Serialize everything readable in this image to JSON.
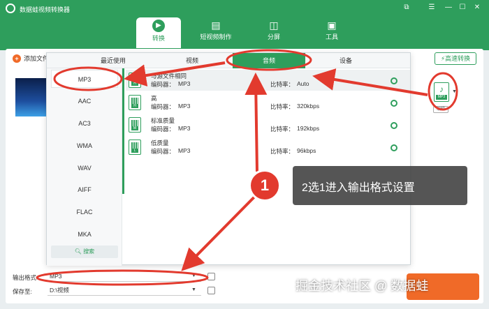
{
  "app": {
    "title": "数据蛙视频转换器"
  },
  "window_controls": [
    "⧉",
    "☰",
    "—",
    "☐",
    "✕"
  ],
  "nav_tabs": [
    {
      "label": "转换",
      "icon": "convert-icon"
    },
    {
      "label": "短视频制作",
      "icon": "film-icon"
    },
    {
      "label": "分屏",
      "icon": "split-screen-icon"
    },
    {
      "label": "工具",
      "icon": "toolbox-icon"
    }
  ],
  "toolbar": {
    "add_file": "添加文件",
    "fast_convert": "高速转换"
  },
  "output_format_icon": {
    "glyph": "♪",
    "label": "MP3",
    "edit": "编辑"
  },
  "popup": {
    "tabs": [
      "最近使用",
      "视频",
      "音频",
      "设备"
    ],
    "active_tab": "音频",
    "formats": [
      "MP3",
      "AAC",
      "AC3",
      "WMA",
      "WAV",
      "AIFF",
      "FLAC",
      "MKA"
    ],
    "active_format": "MP3",
    "search_label": "搜索",
    "codec_label": "编码器：",
    "bitrate_label": "比特率：",
    "qualities": [
      {
        "name": "与源文件相同",
        "codec": "MP3",
        "bitrate": "Auto",
        "tag": "H"
      },
      {
        "name": "高",
        "codec": "MP3",
        "bitrate": "320kbps",
        "tag": "H"
      },
      {
        "name": "标准质量",
        "codec": "MP3",
        "bitrate": "192kbps",
        "tag": "M"
      },
      {
        "name": "低质量",
        "codec": "MP3",
        "bitrate": "96kbps",
        "tag": "L"
      }
    ]
  },
  "bottom": {
    "output_format_label": "输出格式",
    "output_format_value": "MP3",
    "save_to_label": "保存至:",
    "save_to_value": "D:\\视频"
  },
  "annotation": {
    "step_number": "1",
    "text": "2选1进入输出格式设置"
  },
  "watermark": "掘金技术社区 @ 数据蛙",
  "colors": {
    "brand_green": "#2e9e5c",
    "accent_orange": "#f06a28",
    "annotation_red": "#e23a2e"
  }
}
